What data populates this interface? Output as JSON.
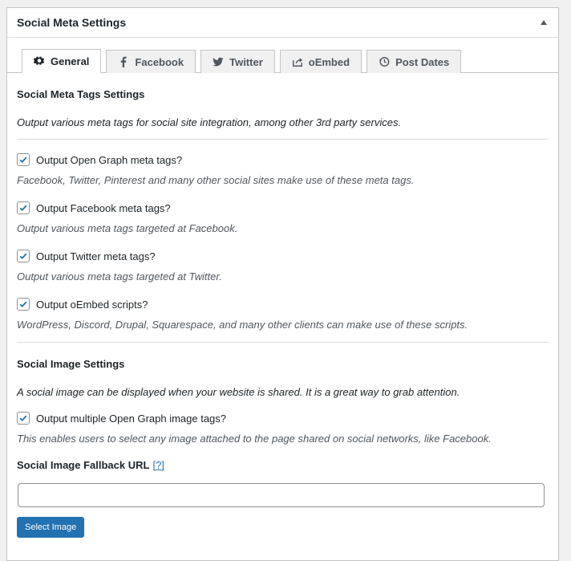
{
  "panel": {
    "title": "Social Meta Settings"
  },
  "tabs": [
    {
      "label": "General",
      "icon": "gear-icon",
      "active": true
    },
    {
      "label": "Facebook",
      "icon": "facebook-icon"
    },
    {
      "label": "Twitter",
      "icon": "twitter-icon"
    },
    {
      "label": "oEmbed",
      "icon": "share-icon"
    },
    {
      "label": "Post Dates",
      "icon": "clock-icon"
    }
  ],
  "meta_tags": {
    "heading": "Social Meta Tags Settings",
    "intro": "Output various meta tags for social site integration, among other 3rd party services.",
    "options": [
      {
        "label": "Output Open Graph meta tags?",
        "checked": true,
        "desc": "Facebook, Twitter, Pinterest and many other social sites make use of these meta tags."
      },
      {
        "label": "Output Facebook meta tags?",
        "checked": true,
        "desc": "Output various meta tags targeted at Facebook."
      },
      {
        "label": "Output Twitter meta tags?",
        "checked": true,
        "desc": "Output various meta tags targeted at Twitter."
      },
      {
        "label": "Output oEmbed scripts?",
        "checked": true,
        "desc": "WordPress, Discord, Drupal, Squarespace, and many other clients can make use of these scripts."
      }
    ]
  },
  "image": {
    "heading": "Social Image Settings",
    "intro": "A social image can be displayed when your website is shared. It is a great way to grab attention.",
    "option": {
      "label": "Output multiple Open Graph image tags?",
      "checked": true,
      "desc": "This enables users to select any image attached to the page shared on social networks, like Facebook."
    },
    "fallback_label": "Social Image Fallback URL",
    "help_link": "[?]",
    "fallback_value": "",
    "button_label": "Select Image"
  },
  "colors": {
    "accent": "#2271b1",
    "check": "#2271b1",
    "border": "#c3c4c7"
  }
}
